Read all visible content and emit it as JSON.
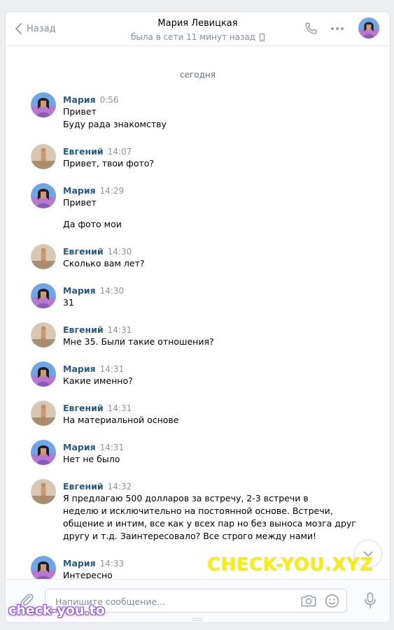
{
  "header": {
    "back_label": "Назад",
    "contact_name": "Мария Левицкая",
    "status_text": "была в сети 11 минут назад"
  },
  "date_separator": "сегодня",
  "messages": [
    {
      "author": "Мария",
      "time": "0:56",
      "lines": [
        "Привет",
        "Буду рада знакомству"
      ]
    },
    {
      "author": "Евгений",
      "time": "14:07",
      "lines": [
        "Привет, твои фото?"
      ]
    },
    {
      "author": "Мария",
      "time": "14:29",
      "lines": [
        "Привет",
        "Да фото мои"
      ]
    },
    {
      "author": "Евгений",
      "time": "14:30",
      "lines": [
        "Сколько вам лет?"
      ]
    },
    {
      "author": "Мария",
      "time": "14:30",
      "lines": [
        "31"
      ]
    },
    {
      "author": "Евгений",
      "time": "14:31",
      "lines": [
        "Мне 35. Были такие отношения?"
      ]
    },
    {
      "author": "Мария",
      "time": "14:31",
      "lines": [
        "Какие именно?"
      ]
    },
    {
      "author": "Евгений",
      "time": "14:31",
      "lines": [
        "На материальной основе"
      ]
    },
    {
      "author": "Мария",
      "time": "14:31",
      "lines": [
        "Нет не было"
      ]
    },
    {
      "author": "Евгений",
      "time": "14:32",
      "lines": [
        "Я предлагаю 500 долларов за встречу, 2-3 встречи в",
        "неделю и исключительно на постоянной основе. Встречи,",
        "общение и интим, все как у всех пар но без выноса мозга друг",
        "другу и т.д. Заинтересовало? Все строго между нами!"
      ]
    },
    {
      "author": "Мария",
      "time": "14:33",
      "lines": [
        "Интересно"
      ]
    }
  ],
  "composer": {
    "placeholder": "Напишите сообщение..."
  },
  "watermarks": {
    "main": "CHECK-YOU.XYZ",
    "corner": "check-you.to"
  },
  "colors": {
    "author_link": "#2a5885",
    "muted_text": "#818c99",
    "watermark_yellow": "#f3ed1e",
    "watermark_purple": "#8a4fd6"
  },
  "icons": [
    "chevron-left-icon",
    "phone-icon",
    "more-icon",
    "camera-icon",
    "emoji-icon",
    "paperclip-icon",
    "microphone-icon",
    "chevron-down-icon"
  ]
}
